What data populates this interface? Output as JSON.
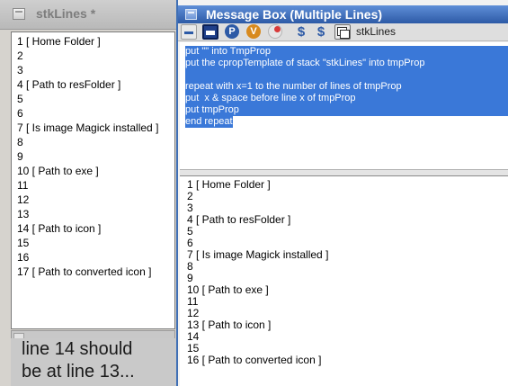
{
  "left_window": {
    "title": "stkLines *",
    "field_lines": [
      "1 [ Home Folder ]",
      "2",
      "3",
      "4 [ Path to resFolder ]",
      "5",
      "6",
      "7 [ Is image Magick installed ]",
      "8",
      "9",
      "10 [ Path to exe ]",
      "11",
      "12",
      "13",
      "14 [ Path to icon ]",
      "15",
      "16",
      "17 [ Path to converted icon ]"
    ]
  },
  "annotation": {
    "line1": "line 14 should",
    "line2": "be at line 13..."
  },
  "message_box": {
    "title": "Message Box (Multiple Lines)",
    "toolbar": {
      "single_line_icon": "single-line-icon",
      "multi_line_icon": "multi-line-icon",
      "p_label": "P",
      "v_label": "V",
      "target_stack": "stkLines"
    },
    "script_lines": [
      "put \"\" into TmpProp",
      "put the cpropTemplate of stack \"stkLines\" into tmpProp",
      "",
      "repeat with x=1 to the number of lines of tmpProp",
      "put  x & space before line x of tmpProp",
      "put tmpProp",
      "end repeat"
    ],
    "result_lines": [
      "1 [ Home Folder ]",
      "2",
      "3",
      "4 [ Path to resFolder ]",
      "5",
      "6",
      "7 [ Is image Magick installed ]",
      "8",
      "9",
      "10 [ Path to exe ]",
      "11",
      "12",
      "13 [ Path to icon ]",
      "14",
      "15",
      "16 [ Path to converted icon ]"
    ]
  },
  "colors": {
    "title_active": "#2d5aa6",
    "selection": "#3a78d8"
  }
}
